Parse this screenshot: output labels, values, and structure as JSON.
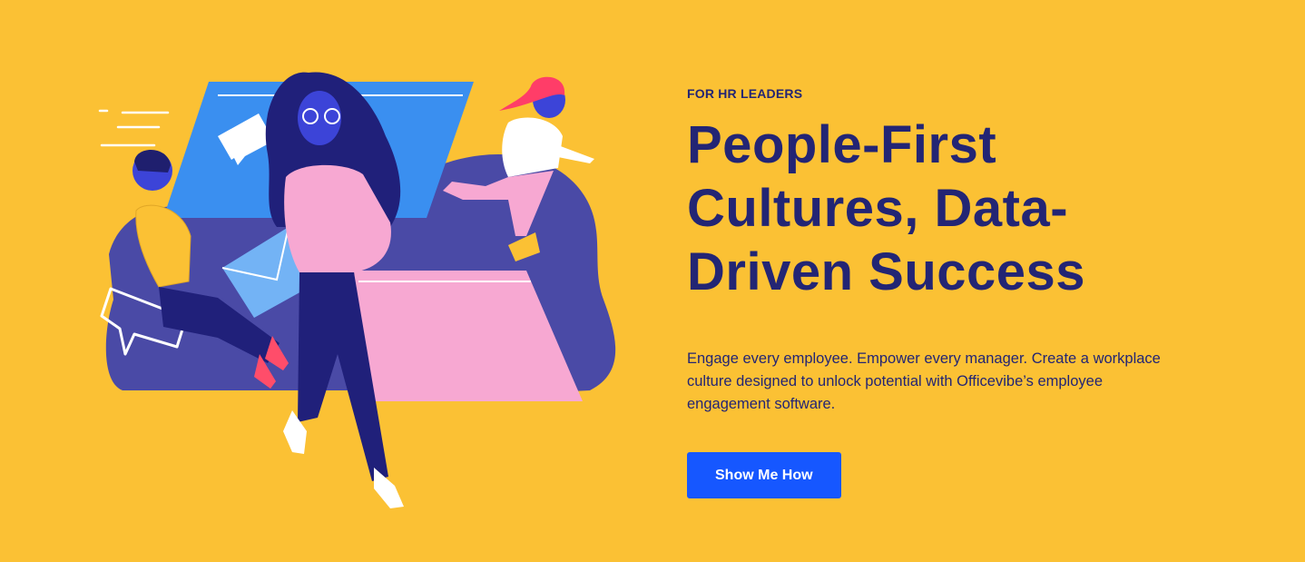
{
  "hero": {
    "eyebrow": "FOR HR LEADERS",
    "headline_lines": [
      "People-First",
      "Cultures, Data-",
      "Driven Success"
    ],
    "body": "Engage every employee. Empower every manager. Create a workplace culture designed to unlock potential with Officevibe’s employee engagement software.",
    "cta_label": "Show Me How"
  },
  "colors": {
    "background": "#fbc134",
    "headline": "#232574",
    "cta_background": "#1657ff",
    "cta_text": "#ffffff",
    "illustration_navy": "#4a4aa6",
    "illustration_sky": "#3a8ff0",
    "illustration_pink": "#f7a8d2"
  },
  "icons": [
    "chat-bubble-icon",
    "envelope-icon",
    "tablet-icon"
  ]
}
